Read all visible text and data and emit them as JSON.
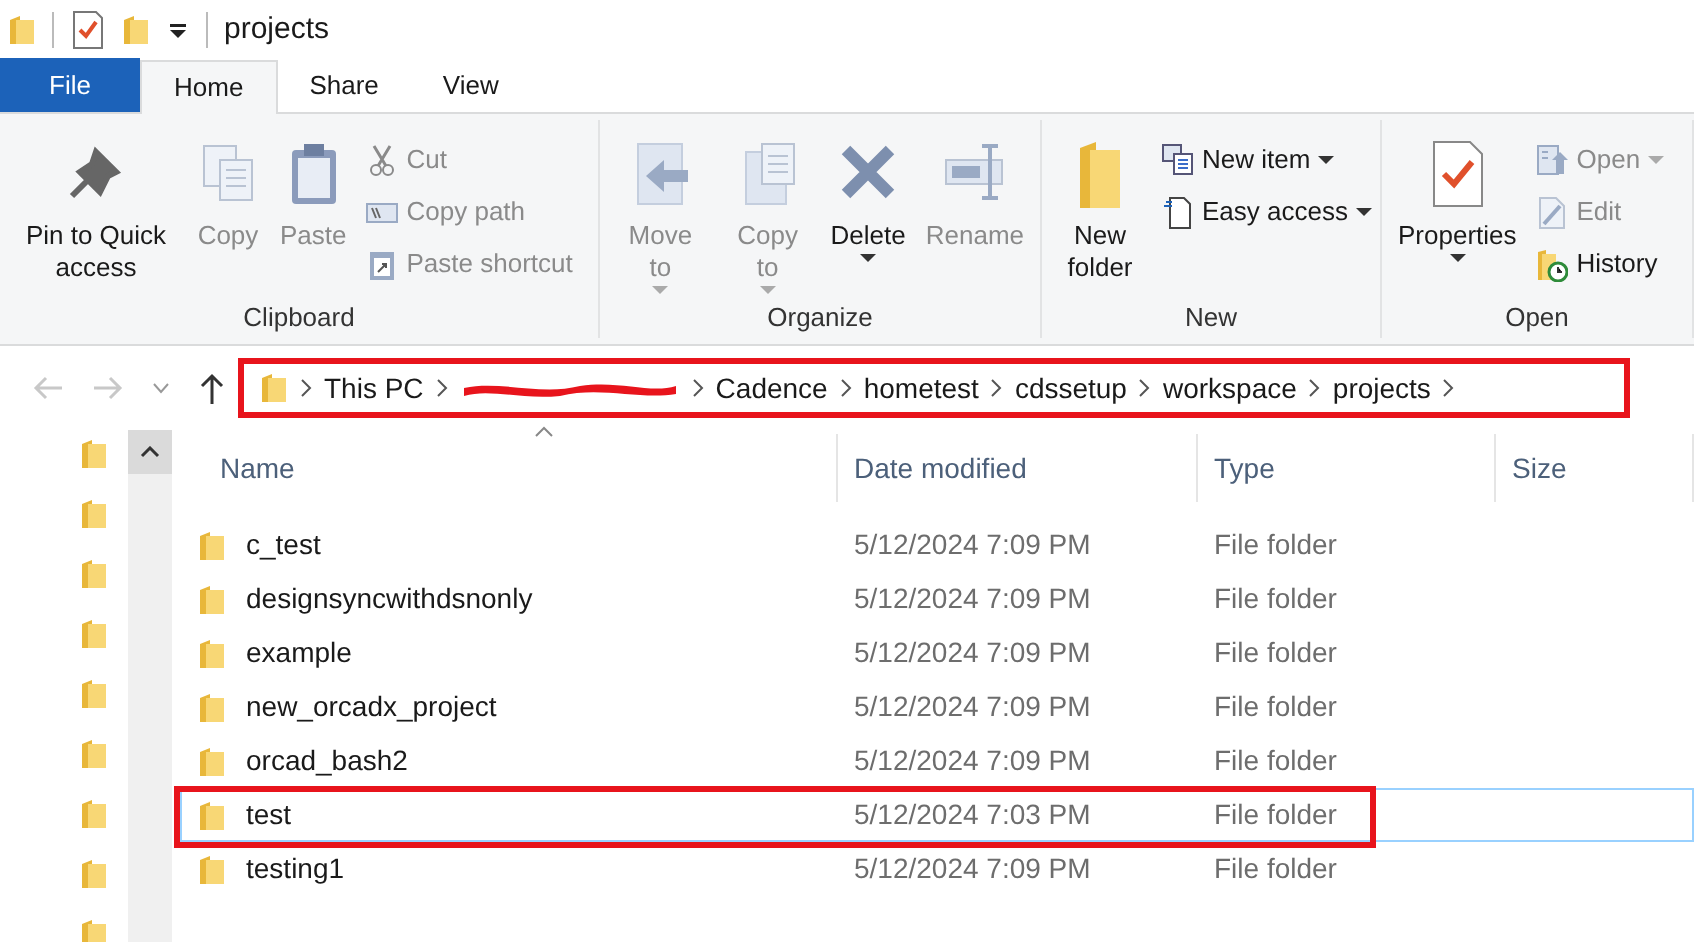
{
  "window": {
    "title": "projects"
  },
  "ribbon_tabs": [
    {
      "label": "File",
      "kind": "file",
      "selected": false
    },
    {
      "label": "Home",
      "kind": "tab",
      "selected": true
    },
    {
      "label": "Share",
      "kind": "tab",
      "selected": false
    },
    {
      "label": "View",
      "kind": "tab",
      "selected": false
    }
  ],
  "ribbon_groups": [
    {
      "label": "Clipboard",
      "large_buttons": [
        {
          "label": "Pin to Quick access",
          "disabled": false,
          "dropdown": false
        },
        {
          "label": "Copy",
          "disabled": true,
          "dropdown": false
        },
        {
          "label": "Paste",
          "disabled": true,
          "dropdown": false
        }
      ],
      "small_buttons": [
        {
          "label": "Cut",
          "disabled": true,
          "dropdown": false
        },
        {
          "label": "Copy path",
          "disabled": true,
          "dropdown": false
        },
        {
          "label": "Paste shortcut",
          "disabled": true,
          "dropdown": false
        }
      ]
    },
    {
      "label": "Organize",
      "large_buttons": [
        {
          "label": "Move to",
          "disabled": true,
          "dropdown": true
        },
        {
          "label": "Copy to",
          "disabled": true,
          "dropdown": true
        },
        {
          "label": "Delete",
          "disabled": false,
          "dropdown": true
        },
        {
          "label": "Rename",
          "disabled": true,
          "dropdown": false
        }
      ]
    },
    {
      "label": "New",
      "large_buttons": [
        {
          "label": "New folder",
          "disabled": false,
          "dropdown": false
        }
      ],
      "small_buttons": [
        {
          "label": "New item",
          "disabled": false,
          "dropdown": true
        },
        {
          "label": "Easy access",
          "disabled": false,
          "dropdown": true
        }
      ]
    },
    {
      "label": "Open",
      "large_buttons": [
        {
          "label": "Properties",
          "disabled": false,
          "dropdown": true
        }
      ],
      "small_buttons": [
        {
          "label": "Open",
          "disabled": true,
          "dropdown": true
        },
        {
          "label": "Edit",
          "disabled": true,
          "dropdown": false
        },
        {
          "label": "History",
          "disabled": false,
          "dropdown": false
        }
      ]
    }
  ],
  "navigation": {
    "back_disabled": true,
    "forward_disabled": true
  },
  "address_bar": {
    "highlighted": true,
    "crumbs": [
      {
        "kind": "text",
        "label": "This PC"
      },
      {
        "kind": "redacted"
      },
      {
        "kind": "text",
        "label": "Cadence"
      },
      {
        "kind": "text",
        "label": "hometest"
      },
      {
        "kind": "text",
        "label": "cdssetup"
      },
      {
        "kind": "text",
        "label": "workspace"
      },
      {
        "kind": "text",
        "label": "projects"
      }
    ]
  },
  "columns": [
    {
      "label": "Name",
      "sorted": true
    },
    {
      "label": "Date modified",
      "sorted": false
    },
    {
      "label": "Type",
      "sorted": false
    },
    {
      "label": "Size",
      "sorted": false
    }
  ],
  "rows": [
    {
      "name": "c_test",
      "date": "5/12/2024 7:09 PM",
      "type": "File folder",
      "selected": false,
      "highlighted": false
    },
    {
      "name": "designsyncwithdsnonly",
      "date": "5/12/2024 7:09 PM",
      "type": "File folder",
      "selected": false,
      "highlighted": false
    },
    {
      "name": "example",
      "date": "5/12/2024 7:09 PM",
      "type": "File folder",
      "selected": false,
      "highlighted": false
    },
    {
      "name": "new_orcadx_project",
      "date": "5/12/2024 7:09 PM",
      "type": "File folder",
      "selected": false,
      "highlighted": false
    },
    {
      "name": "orcad_bash2",
      "date": "5/12/2024 7:09 PM",
      "type": "File folder",
      "selected": false,
      "highlighted": false
    },
    {
      "name": "test",
      "date": "5/12/2024 7:03 PM",
      "type": "File folder",
      "selected": true,
      "highlighted": true
    },
    {
      "name": "testing1",
      "date": "5/12/2024 7:09 PM",
      "type": "File folder",
      "selected": false,
      "highlighted": false
    }
  ]
}
